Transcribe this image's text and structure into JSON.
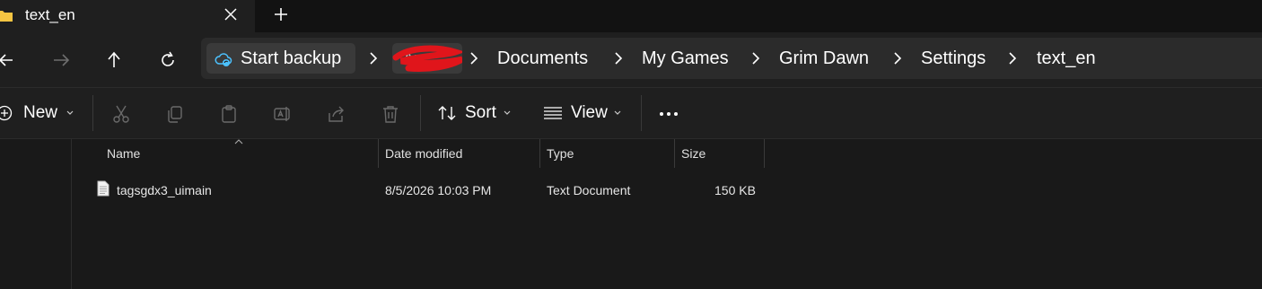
{
  "tab": {
    "title": "text_en"
  },
  "toolbar": {
    "backup_label": "Start backup",
    "user_crumb_partial": "Ar..",
    "breadcrumbs": [
      "Documents",
      "My Games",
      "Grim Dawn",
      "Settings",
      "text_en"
    ]
  },
  "commands": {
    "new_label": "New",
    "sort_label": "Sort",
    "view_label": "View"
  },
  "columns": {
    "name": "Name",
    "date": "Date modified",
    "type": "Type",
    "size": "Size"
  },
  "files": [
    {
      "name": "tagsgdx3_uimain",
      "date": "8/5/2026 10:03 PM",
      "type": "Text Document",
      "size": "150 KB"
    }
  ],
  "colors": {
    "accent": "#4cc2ff",
    "folder": "#f5c542",
    "redaction": "#e0151b"
  },
  "icons": {
    "tab": "folder-icon",
    "backup": "cloud-sync-icon",
    "nav": [
      "back-arrow-icon",
      "forward-arrow-icon",
      "up-arrow-icon",
      "refresh-icon"
    ],
    "commands": [
      "cut-icon",
      "copy-icon",
      "paste-icon",
      "rename-icon",
      "share-icon",
      "delete-icon",
      "more-icon"
    ],
    "file": "text-document-icon"
  }
}
